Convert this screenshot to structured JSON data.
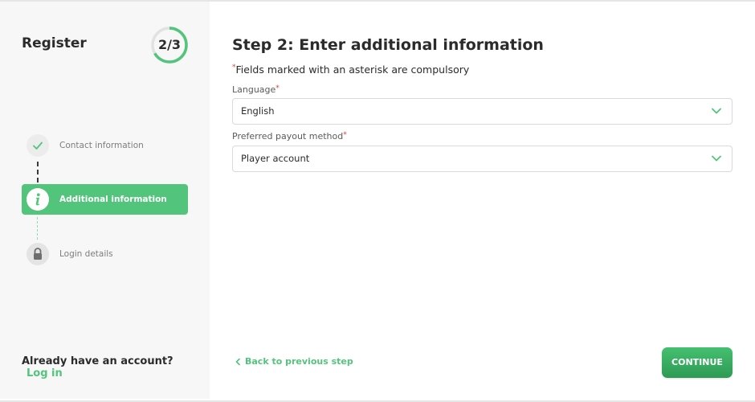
{
  "sidebar": {
    "title": "Register",
    "progress": {
      "current": 2,
      "total": 3,
      "label": "2/3"
    },
    "steps": [
      {
        "label": "Contact information",
        "status": "completed",
        "icon": "check-icon"
      },
      {
        "label": "Additional information",
        "status": "active",
        "icon": "info-icon"
      },
      {
        "label": "Login details",
        "status": "locked",
        "icon": "lock-icon"
      }
    ],
    "already_text": "Already have an account?",
    "login_link": "Log in"
  },
  "main": {
    "title": "Step 2: Enter additional information",
    "required_marker": "*",
    "required_note": "Fields marked with an asterisk are compulsory",
    "fields": [
      {
        "label": "Language",
        "required": true,
        "value": "English"
      },
      {
        "label": "Preferred payout method",
        "required": true,
        "value": "Player account"
      }
    ],
    "back_label": "Back to previous step",
    "continue_label": "CONTINUE"
  },
  "colors": {
    "accent": "#52c47c",
    "button_dark": "#2e9a55",
    "required": "#e23a3a",
    "sidebar_bg": "#f7f7f7",
    "text": "#2b2b2b"
  }
}
